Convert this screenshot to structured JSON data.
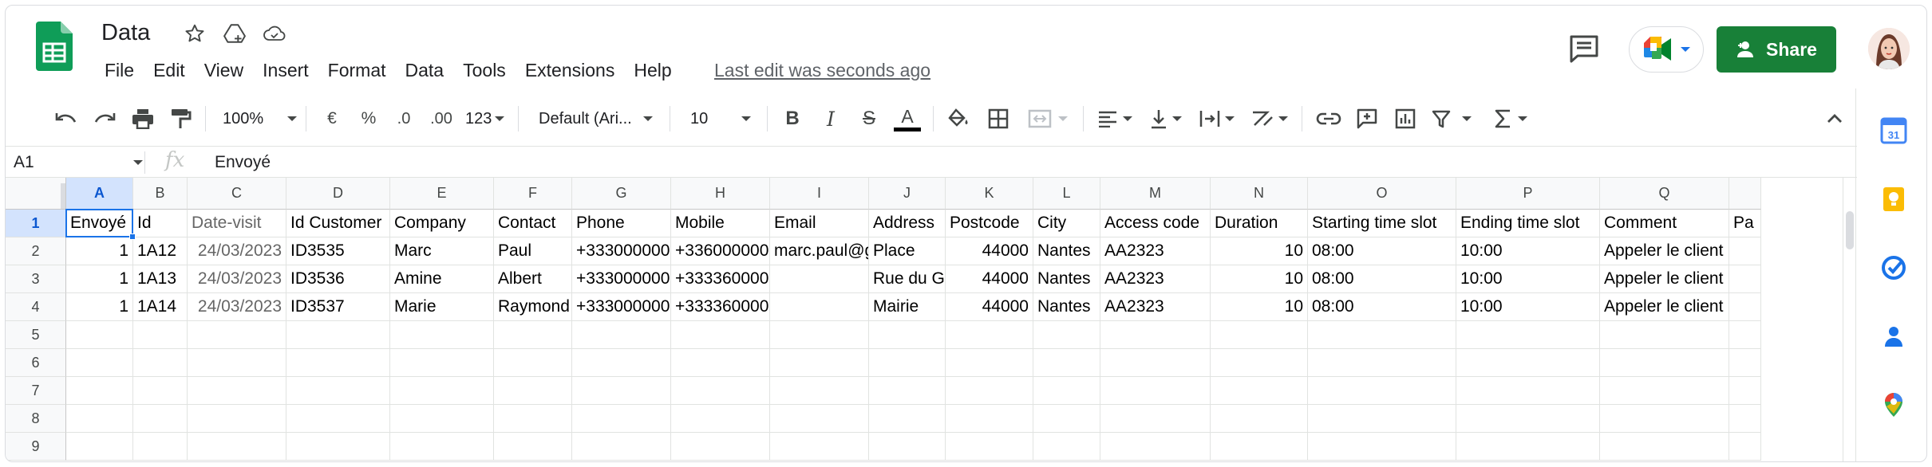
{
  "doc": {
    "title": "Data"
  },
  "menu": [
    "File",
    "Edit",
    "View",
    "Insert",
    "Format",
    "Data",
    "Tools",
    "Extensions",
    "Help"
  ],
  "last_edit": "Last edit was seconds ago",
  "share_label": "Share",
  "toolbar": {
    "zoom": "100%",
    "currency": "€",
    "percent": "%",
    "dec_decrease": ".0",
    "dec_increase": ".00",
    "more_formats": "123",
    "font": "Default (Ari...",
    "font_size": "10",
    "bold": "B",
    "italic": "I",
    "strike": "S",
    "text_color": "A",
    "text_color_value": "#000000"
  },
  "formula_bar": {
    "name_box": "A1",
    "fx": "fx",
    "content": "Envoyé"
  },
  "grid": {
    "columns": [
      "A",
      "B",
      "C",
      "D",
      "E",
      "F",
      "G",
      "H",
      "I",
      "J",
      "K",
      "L",
      "M",
      "N",
      "O",
      "P",
      "Q"
    ],
    "row_numbers": [
      "1",
      "2",
      "3",
      "4",
      "5",
      "6",
      "7",
      "8",
      "9"
    ],
    "rows": [
      [
        "Envoyé",
        "Id",
        "Date-visit",
        "Id Customer",
        "Company",
        "Contact",
        "Phone",
        "Mobile",
        "Email",
        "Address",
        "Postcode",
        "City",
        "Access code",
        "Duration",
        "Starting time slot",
        "Ending time slot",
        "Comment",
        "Pa"
      ],
      [
        "1",
        "1A12",
        "24/03/2023",
        "ID3535",
        "Marc",
        "Paul",
        "+333000000",
        "+336000000",
        "marc.paul@g",
        "Place",
        "44000",
        "Nantes",
        "AA2323",
        "10",
        "08:00",
        "10:00",
        "Appeler le client",
        ""
      ],
      [
        "1",
        "1A13",
        "24/03/2023",
        "ID3536",
        "Amine",
        "Albert",
        "+333000000",
        "+333360000",
        "",
        "Rue du G",
        "44000",
        "Nantes",
        "AA2323",
        "10",
        "08:00",
        "10:00",
        "Appeler le client",
        ""
      ],
      [
        "1",
        "1A14",
        "24/03/2023",
        "ID3537",
        "Marie",
        "Raymond",
        "+333000000",
        "+333360000",
        "",
        "Mairie",
        "44000",
        "Nantes",
        "AA2323",
        "10",
        "08:00",
        "10:00",
        "Appeler le client",
        ""
      ]
    ]
  },
  "side_panel": [
    "calendar-icon",
    "keep-icon",
    "tasks-icon",
    "contacts-icon",
    "maps-icon"
  ],
  "colors": {
    "share_bg": "#188038",
    "selection": "#1a73e8",
    "header_selected": "#d3e3fd"
  }
}
